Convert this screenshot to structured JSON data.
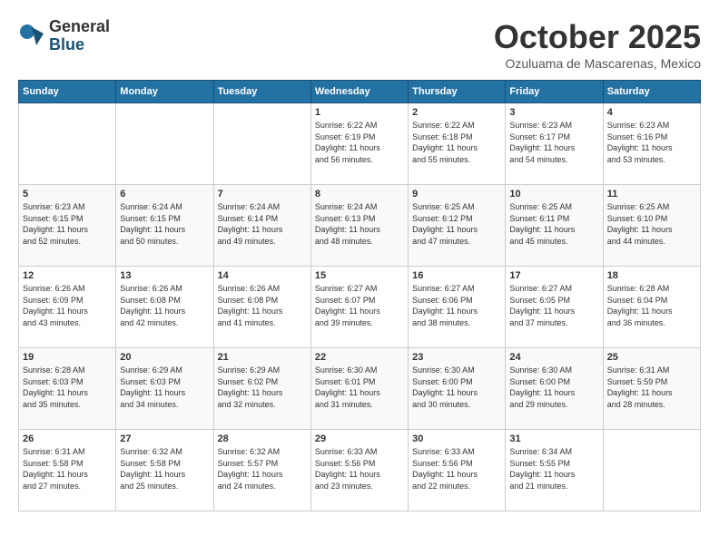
{
  "logo": {
    "general": "General",
    "blue": "Blue"
  },
  "header": {
    "month": "October 2025",
    "location": "Ozuluama de Mascarenas, Mexico"
  },
  "days_of_week": [
    "Sunday",
    "Monday",
    "Tuesday",
    "Wednesday",
    "Thursday",
    "Friday",
    "Saturday"
  ],
  "weeks": [
    [
      {
        "day": "",
        "info": ""
      },
      {
        "day": "",
        "info": ""
      },
      {
        "day": "",
        "info": ""
      },
      {
        "day": "1",
        "info": "Sunrise: 6:22 AM\nSunset: 6:19 PM\nDaylight: 11 hours\nand 56 minutes."
      },
      {
        "day": "2",
        "info": "Sunrise: 6:22 AM\nSunset: 6:18 PM\nDaylight: 11 hours\nand 55 minutes."
      },
      {
        "day": "3",
        "info": "Sunrise: 6:23 AM\nSunset: 6:17 PM\nDaylight: 11 hours\nand 54 minutes."
      },
      {
        "day": "4",
        "info": "Sunrise: 6:23 AM\nSunset: 6:16 PM\nDaylight: 11 hours\nand 53 minutes."
      }
    ],
    [
      {
        "day": "5",
        "info": "Sunrise: 6:23 AM\nSunset: 6:15 PM\nDaylight: 11 hours\nand 52 minutes."
      },
      {
        "day": "6",
        "info": "Sunrise: 6:24 AM\nSunset: 6:15 PM\nDaylight: 11 hours\nand 50 minutes."
      },
      {
        "day": "7",
        "info": "Sunrise: 6:24 AM\nSunset: 6:14 PM\nDaylight: 11 hours\nand 49 minutes."
      },
      {
        "day": "8",
        "info": "Sunrise: 6:24 AM\nSunset: 6:13 PM\nDaylight: 11 hours\nand 48 minutes."
      },
      {
        "day": "9",
        "info": "Sunrise: 6:25 AM\nSunset: 6:12 PM\nDaylight: 11 hours\nand 47 minutes."
      },
      {
        "day": "10",
        "info": "Sunrise: 6:25 AM\nSunset: 6:11 PM\nDaylight: 11 hours\nand 45 minutes."
      },
      {
        "day": "11",
        "info": "Sunrise: 6:25 AM\nSunset: 6:10 PM\nDaylight: 11 hours\nand 44 minutes."
      }
    ],
    [
      {
        "day": "12",
        "info": "Sunrise: 6:26 AM\nSunset: 6:09 PM\nDaylight: 11 hours\nand 43 minutes."
      },
      {
        "day": "13",
        "info": "Sunrise: 6:26 AM\nSunset: 6:08 PM\nDaylight: 11 hours\nand 42 minutes."
      },
      {
        "day": "14",
        "info": "Sunrise: 6:26 AM\nSunset: 6:08 PM\nDaylight: 11 hours\nand 41 minutes."
      },
      {
        "day": "15",
        "info": "Sunrise: 6:27 AM\nSunset: 6:07 PM\nDaylight: 11 hours\nand 39 minutes."
      },
      {
        "day": "16",
        "info": "Sunrise: 6:27 AM\nSunset: 6:06 PM\nDaylight: 11 hours\nand 38 minutes."
      },
      {
        "day": "17",
        "info": "Sunrise: 6:27 AM\nSunset: 6:05 PM\nDaylight: 11 hours\nand 37 minutes."
      },
      {
        "day": "18",
        "info": "Sunrise: 6:28 AM\nSunset: 6:04 PM\nDaylight: 11 hours\nand 36 minutes."
      }
    ],
    [
      {
        "day": "19",
        "info": "Sunrise: 6:28 AM\nSunset: 6:03 PM\nDaylight: 11 hours\nand 35 minutes."
      },
      {
        "day": "20",
        "info": "Sunrise: 6:29 AM\nSunset: 6:03 PM\nDaylight: 11 hours\nand 34 minutes."
      },
      {
        "day": "21",
        "info": "Sunrise: 6:29 AM\nSunset: 6:02 PM\nDaylight: 11 hours\nand 32 minutes."
      },
      {
        "day": "22",
        "info": "Sunrise: 6:30 AM\nSunset: 6:01 PM\nDaylight: 11 hours\nand 31 minutes."
      },
      {
        "day": "23",
        "info": "Sunrise: 6:30 AM\nSunset: 6:00 PM\nDaylight: 11 hours\nand 30 minutes."
      },
      {
        "day": "24",
        "info": "Sunrise: 6:30 AM\nSunset: 6:00 PM\nDaylight: 11 hours\nand 29 minutes."
      },
      {
        "day": "25",
        "info": "Sunrise: 6:31 AM\nSunset: 5:59 PM\nDaylight: 11 hours\nand 28 minutes."
      }
    ],
    [
      {
        "day": "26",
        "info": "Sunrise: 6:31 AM\nSunset: 5:58 PM\nDaylight: 11 hours\nand 27 minutes."
      },
      {
        "day": "27",
        "info": "Sunrise: 6:32 AM\nSunset: 5:58 PM\nDaylight: 11 hours\nand 25 minutes."
      },
      {
        "day": "28",
        "info": "Sunrise: 6:32 AM\nSunset: 5:57 PM\nDaylight: 11 hours\nand 24 minutes."
      },
      {
        "day": "29",
        "info": "Sunrise: 6:33 AM\nSunset: 5:56 PM\nDaylight: 11 hours\nand 23 minutes."
      },
      {
        "day": "30",
        "info": "Sunrise: 6:33 AM\nSunset: 5:56 PM\nDaylight: 11 hours\nand 22 minutes."
      },
      {
        "day": "31",
        "info": "Sunrise: 6:34 AM\nSunset: 5:55 PM\nDaylight: 11 hours\nand 21 minutes."
      },
      {
        "day": "",
        "info": ""
      }
    ]
  ]
}
